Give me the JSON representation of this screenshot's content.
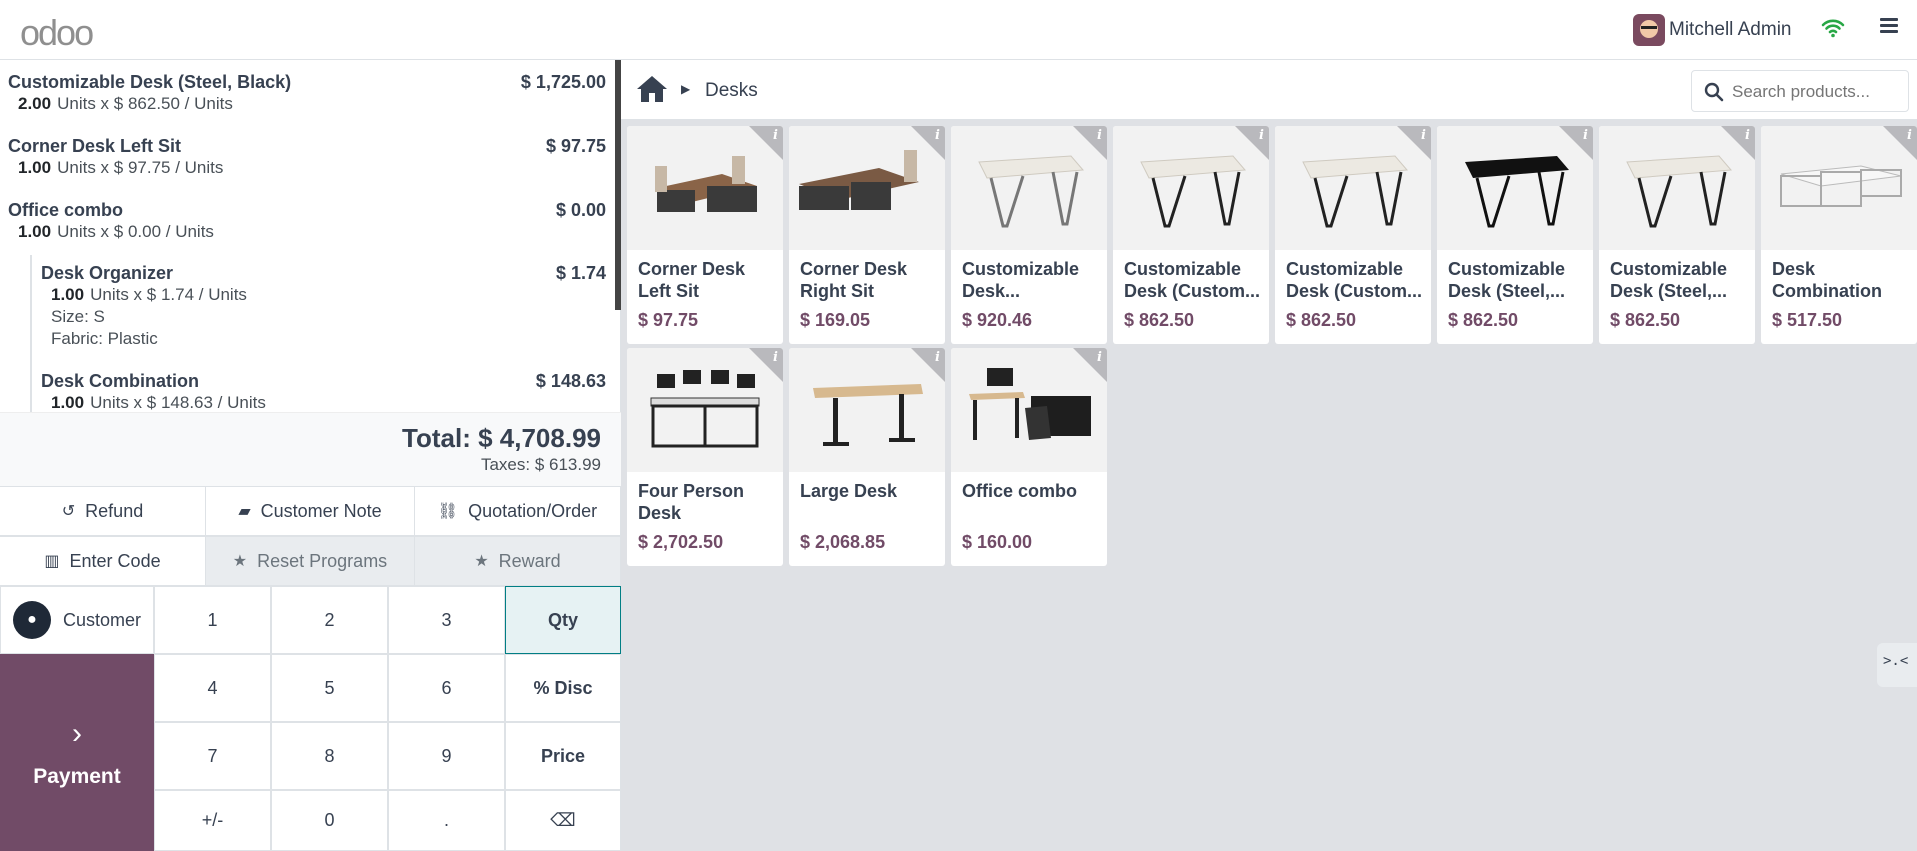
{
  "app": {
    "logo": "odoo"
  },
  "header": {
    "user_name": "Mitchell Admin"
  },
  "order": {
    "lines": [
      {
        "name": "Customizable Desk (Steel, Black)",
        "qty": "2.00",
        "unit_text": "Units x $ 862.50 / Units",
        "price": "$ 1,725.00"
      },
      {
        "name": "Corner Desk Left Sit",
        "qty": "1.00",
        "unit_text": "Units x $ 97.75 / Units",
        "price": "$ 97.75"
      },
      {
        "name": "Office combo",
        "qty": "1.00",
        "unit_text": "Units x $ 0.00 / Units",
        "price": "$ 0.00"
      },
      {
        "name": "Desk Organizer",
        "qty": "1.00",
        "unit_text": "Units x $ 1.74 / Units",
        "price": "$ 1.74",
        "attributes": [
          "Size: S",
          "Fabric: Plastic"
        ]
      },
      {
        "name": "Desk Combination",
        "qty": "1.00",
        "unit_text": "Units x $ 148.63 / Units",
        "price": "$ 148.63"
      }
    ],
    "total": "Total: $ 4,708.99",
    "taxes": "Taxes: $ 613.99"
  },
  "controls": {
    "refund": "Refund",
    "customer_note": "Customer Note",
    "quotation_order": "Quotation/Order",
    "enter_code": "Enter Code",
    "reset_programs": "Reset Programs",
    "reward": "Reward"
  },
  "numpad": {
    "customer": "Customer",
    "payment": "Payment",
    "keys": [
      "1",
      "2",
      "3",
      "Qty",
      "4",
      "5",
      "6",
      "% Disc",
      "7",
      "8",
      "9",
      "Price",
      "+/-",
      "0",
      ".",
      "⌫"
    ]
  },
  "products_header": {
    "breadcrumb": "Desks",
    "search_placeholder": "Search products..."
  },
  "products": [
    {
      "name": "Corner Desk Left Sit",
      "price": "$ 97.75"
    },
    {
      "name": "Corner Desk Right Sit",
      "price": "$ 169.05"
    },
    {
      "name": "Customizable Desk...",
      "price": "$ 920.46"
    },
    {
      "name": "Customizable Desk (Custom...",
      "price": "$ 862.50"
    },
    {
      "name": "Customizable Desk (Custom...",
      "price": "$ 862.50"
    },
    {
      "name": "Customizable Desk (Steel,...",
      "price": "$ 862.50"
    },
    {
      "name": "Customizable Desk (Steel,...",
      "price": "$ 862.50"
    },
    {
      "name": "Desk Combination",
      "price": "$ 517.50"
    },
    {
      "name": "Four Person Desk",
      "price": "$ 2,702.50"
    },
    {
      "name": "Large Desk",
      "price": "$ 2,068.85"
    },
    {
      "name": "Office combo",
      "price": "$ 160.00"
    }
  ],
  "colors": {
    "brand": "#714b67",
    "accent": "#017e84",
    "wifi": "#28a745"
  }
}
